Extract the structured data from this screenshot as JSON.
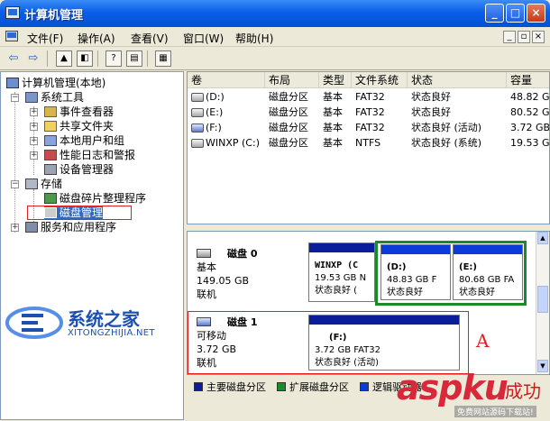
{
  "window": {
    "title": "计算机管理",
    "minimize": "_",
    "maximize": "□",
    "close": "×"
  },
  "menu": {
    "items": [
      "文件(F)",
      "操作(A)",
      "查看(V)",
      "窗口(W)",
      "帮助(H)"
    ],
    "mdi": [
      "_",
      "▫",
      "×"
    ]
  },
  "tree": {
    "root": "计算机管理(本地)",
    "system_tools": "系统工具",
    "event_viewer": "事件查看器",
    "shared_folders": "共享文件夹",
    "local_users": "本地用户和组",
    "perf_logs": "性能日志和警报",
    "device_manager": "设备管理器",
    "storage": "存储",
    "defrag": "磁盘碎片整理程序",
    "disk_mgmt": "磁盘管理",
    "services": "服务和应用程序"
  },
  "volume_list": {
    "headers": [
      "卷",
      "布局",
      "类型",
      "文件系统",
      "状态",
      "容量"
    ],
    "rows": [
      {
        "vol": "(D:)",
        "layout": "磁盘分区",
        "type": "基本",
        "fs": "FAT32",
        "status": "状态良好",
        "cap": "48.82 GB"
      },
      {
        "vol": "(E:)",
        "layout": "磁盘分区",
        "type": "基本",
        "fs": "FAT32",
        "status": "状态良好",
        "cap": "80.52 GB"
      },
      {
        "vol": "(F:)",
        "layout": "磁盘分区",
        "type": "基本",
        "fs": "FAT32",
        "status": "状态良好 (活动)",
        "cap": "3.72 GB"
      },
      {
        "vol": "WINXP (C:)",
        "layout": "磁盘分区",
        "type": "基本",
        "fs": "NTFS",
        "status": "状态良好 (系统)",
        "cap": "19.53 GB"
      }
    ]
  },
  "disks": [
    {
      "name": "磁盘 0",
      "kind": "基本",
      "size": "149.05 GB",
      "state": "联机",
      "parts": [
        {
          "l1": "WINXP (C",
          "l2": "19.53 GB N",
          "l3": "状态良好 (",
          "style": "primary"
        },
        {
          "l1": "(D:)",
          "l2": "48.83 GB F",
          "l3": "状态良好",
          "style": "logical"
        },
        {
          "l1": "(E:)",
          "l2": "80.68 GB FA",
          "l3": "状态良好",
          "style": "logical"
        }
      ]
    },
    {
      "name": "磁盘 1",
      "kind": "可移动",
      "size": "3.72 GB",
      "state": "联机",
      "parts": [
        {
          "l1": "(F:)",
          "l2": "3.72 GB FAT32",
          "l3": "状态良好 (活动)",
          "style": "primary"
        }
      ]
    }
  ],
  "legend": {
    "primary": "主要磁盘分区",
    "extended": "扩展磁盘分区",
    "logical": "逻辑驱动器",
    "colors": {
      "primary": "#0a1e9a",
      "extended": "#1b8a2a",
      "logical": "#0b3bd8"
    }
  },
  "annotation": "A",
  "watermarks": {
    "site_title": "系统之家",
    "site_url": "XITONGZHIJIA.NET",
    "asp": "aspku",
    "success": "成功",
    "note": "免费网站源码下载站!"
  }
}
